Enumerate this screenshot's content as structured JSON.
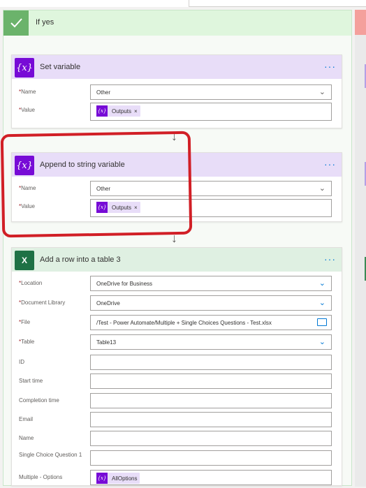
{
  "condition": {
    "title": "If yes"
  },
  "set_variable": {
    "title": "Set variable",
    "more": "···",
    "name_label": "Name",
    "name_value": "Other",
    "value_label": "Value",
    "value_token": "Outputs",
    "token_remove": "×"
  },
  "append_variable": {
    "title": "Append to string variable",
    "more": "···",
    "name_label": "Name",
    "name_value": "Other",
    "value_label": "Value",
    "value_token": "Outputs",
    "token_remove": "×"
  },
  "add_row": {
    "title": "Add a row into a table 3",
    "more": "···",
    "fields": [
      {
        "label": "Location",
        "required": true,
        "value": "OneDrive for Business"
      },
      {
        "label": "Document Library",
        "required": true,
        "value": "OneDrive"
      },
      {
        "label": "File",
        "required": true,
        "value": "/Test - Power Automate/Multiple + Single Choices Questions - Test.xlsx"
      },
      {
        "label": "Table",
        "required": true,
        "value": "Table13"
      },
      {
        "label": "ID",
        "required": false,
        "value": ""
      },
      {
        "label": "Start time",
        "required": false,
        "value": ""
      },
      {
        "label": "Completion time",
        "required": false,
        "value": ""
      },
      {
        "label": "Email",
        "required": false,
        "value": ""
      },
      {
        "label": "Name",
        "required": false,
        "value": ""
      },
      {
        "label": "Single Choice Question 1",
        "required": false,
        "value": ""
      },
      {
        "label": "Multiple - Options",
        "required": false,
        "value": "AllOptions"
      }
    ]
  },
  "glyphs": {
    "required_mark": "*",
    "chevron": "⌄",
    "arrow_down": "↓",
    "var_icon": "{x}",
    "token_icon": "{x}",
    "excel_icon": "X"
  },
  "colors": {
    "required": "#a4262c",
    "accent": "#0078d4",
    "variable": "#770bd6",
    "excel": "#1e7145",
    "highlight": "#d11f26"
  }
}
